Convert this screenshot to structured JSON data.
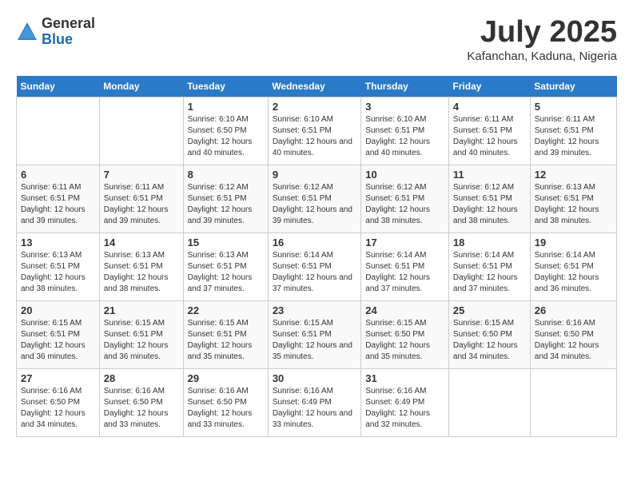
{
  "header": {
    "logo_general": "General",
    "logo_blue": "Blue",
    "month_title": "July 2025",
    "location": "Kafanchan, Kaduna, Nigeria"
  },
  "days_of_week": [
    "Sunday",
    "Monday",
    "Tuesday",
    "Wednesday",
    "Thursday",
    "Friday",
    "Saturday"
  ],
  "weeks": [
    [
      {
        "day": "",
        "empty": true
      },
      {
        "day": "",
        "empty": true
      },
      {
        "day": "1",
        "sunrise": "6:10 AM",
        "sunset": "6:50 PM",
        "daylight": "12 hours and 40 minutes."
      },
      {
        "day": "2",
        "sunrise": "6:10 AM",
        "sunset": "6:51 PM",
        "daylight": "12 hours and 40 minutes."
      },
      {
        "day": "3",
        "sunrise": "6:10 AM",
        "sunset": "6:51 PM",
        "daylight": "12 hours and 40 minutes."
      },
      {
        "day": "4",
        "sunrise": "6:11 AM",
        "sunset": "6:51 PM",
        "daylight": "12 hours and 40 minutes."
      },
      {
        "day": "5",
        "sunrise": "6:11 AM",
        "sunset": "6:51 PM",
        "daylight": "12 hours and 39 minutes."
      }
    ],
    [
      {
        "day": "6",
        "sunrise": "6:11 AM",
        "sunset": "6:51 PM",
        "daylight": "12 hours and 39 minutes."
      },
      {
        "day": "7",
        "sunrise": "6:11 AM",
        "sunset": "6:51 PM",
        "daylight": "12 hours and 39 minutes."
      },
      {
        "day": "8",
        "sunrise": "6:12 AM",
        "sunset": "6:51 PM",
        "daylight": "12 hours and 39 minutes."
      },
      {
        "day": "9",
        "sunrise": "6:12 AM",
        "sunset": "6:51 PM",
        "daylight": "12 hours and 39 minutes."
      },
      {
        "day": "10",
        "sunrise": "6:12 AM",
        "sunset": "6:51 PM",
        "daylight": "12 hours and 38 minutes."
      },
      {
        "day": "11",
        "sunrise": "6:12 AM",
        "sunset": "6:51 PM",
        "daylight": "12 hours and 38 minutes."
      },
      {
        "day": "12",
        "sunrise": "6:13 AM",
        "sunset": "6:51 PM",
        "daylight": "12 hours and 38 minutes."
      }
    ],
    [
      {
        "day": "13",
        "sunrise": "6:13 AM",
        "sunset": "6:51 PM",
        "daylight": "12 hours and 38 minutes."
      },
      {
        "day": "14",
        "sunrise": "6:13 AM",
        "sunset": "6:51 PM",
        "daylight": "12 hours and 38 minutes."
      },
      {
        "day": "15",
        "sunrise": "6:13 AM",
        "sunset": "6:51 PM",
        "daylight": "12 hours and 37 minutes."
      },
      {
        "day": "16",
        "sunrise": "6:14 AM",
        "sunset": "6:51 PM",
        "daylight": "12 hours and 37 minutes."
      },
      {
        "day": "17",
        "sunrise": "6:14 AM",
        "sunset": "6:51 PM",
        "daylight": "12 hours and 37 minutes."
      },
      {
        "day": "18",
        "sunrise": "6:14 AM",
        "sunset": "6:51 PM",
        "daylight": "12 hours and 37 minutes."
      },
      {
        "day": "19",
        "sunrise": "6:14 AM",
        "sunset": "6:51 PM",
        "daylight": "12 hours and 36 minutes."
      }
    ],
    [
      {
        "day": "20",
        "sunrise": "6:15 AM",
        "sunset": "6:51 PM",
        "daylight": "12 hours and 36 minutes."
      },
      {
        "day": "21",
        "sunrise": "6:15 AM",
        "sunset": "6:51 PM",
        "daylight": "12 hours and 36 minutes."
      },
      {
        "day": "22",
        "sunrise": "6:15 AM",
        "sunset": "6:51 PM",
        "daylight": "12 hours and 35 minutes."
      },
      {
        "day": "23",
        "sunrise": "6:15 AM",
        "sunset": "6:51 PM",
        "daylight": "12 hours and 35 minutes."
      },
      {
        "day": "24",
        "sunrise": "6:15 AM",
        "sunset": "6:50 PM",
        "daylight": "12 hours and 35 minutes."
      },
      {
        "day": "25",
        "sunrise": "6:15 AM",
        "sunset": "6:50 PM",
        "daylight": "12 hours and 34 minutes."
      },
      {
        "day": "26",
        "sunrise": "6:16 AM",
        "sunset": "6:50 PM",
        "daylight": "12 hours and 34 minutes."
      }
    ],
    [
      {
        "day": "27",
        "sunrise": "6:16 AM",
        "sunset": "6:50 PM",
        "daylight": "12 hours and 34 minutes."
      },
      {
        "day": "28",
        "sunrise": "6:16 AM",
        "sunset": "6:50 PM",
        "daylight": "12 hours and 33 minutes."
      },
      {
        "day": "29",
        "sunrise": "6:16 AM",
        "sunset": "6:50 PM",
        "daylight": "12 hours and 33 minutes."
      },
      {
        "day": "30",
        "sunrise": "6:16 AM",
        "sunset": "6:49 PM",
        "daylight": "12 hours and 33 minutes."
      },
      {
        "day": "31",
        "sunrise": "6:16 AM",
        "sunset": "6:49 PM",
        "daylight": "12 hours and 32 minutes."
      },
      {
        "day": "",
        "empty": true
      },
      {
        "day": "",
        "empty": true
      }
    ]
  ]
}
